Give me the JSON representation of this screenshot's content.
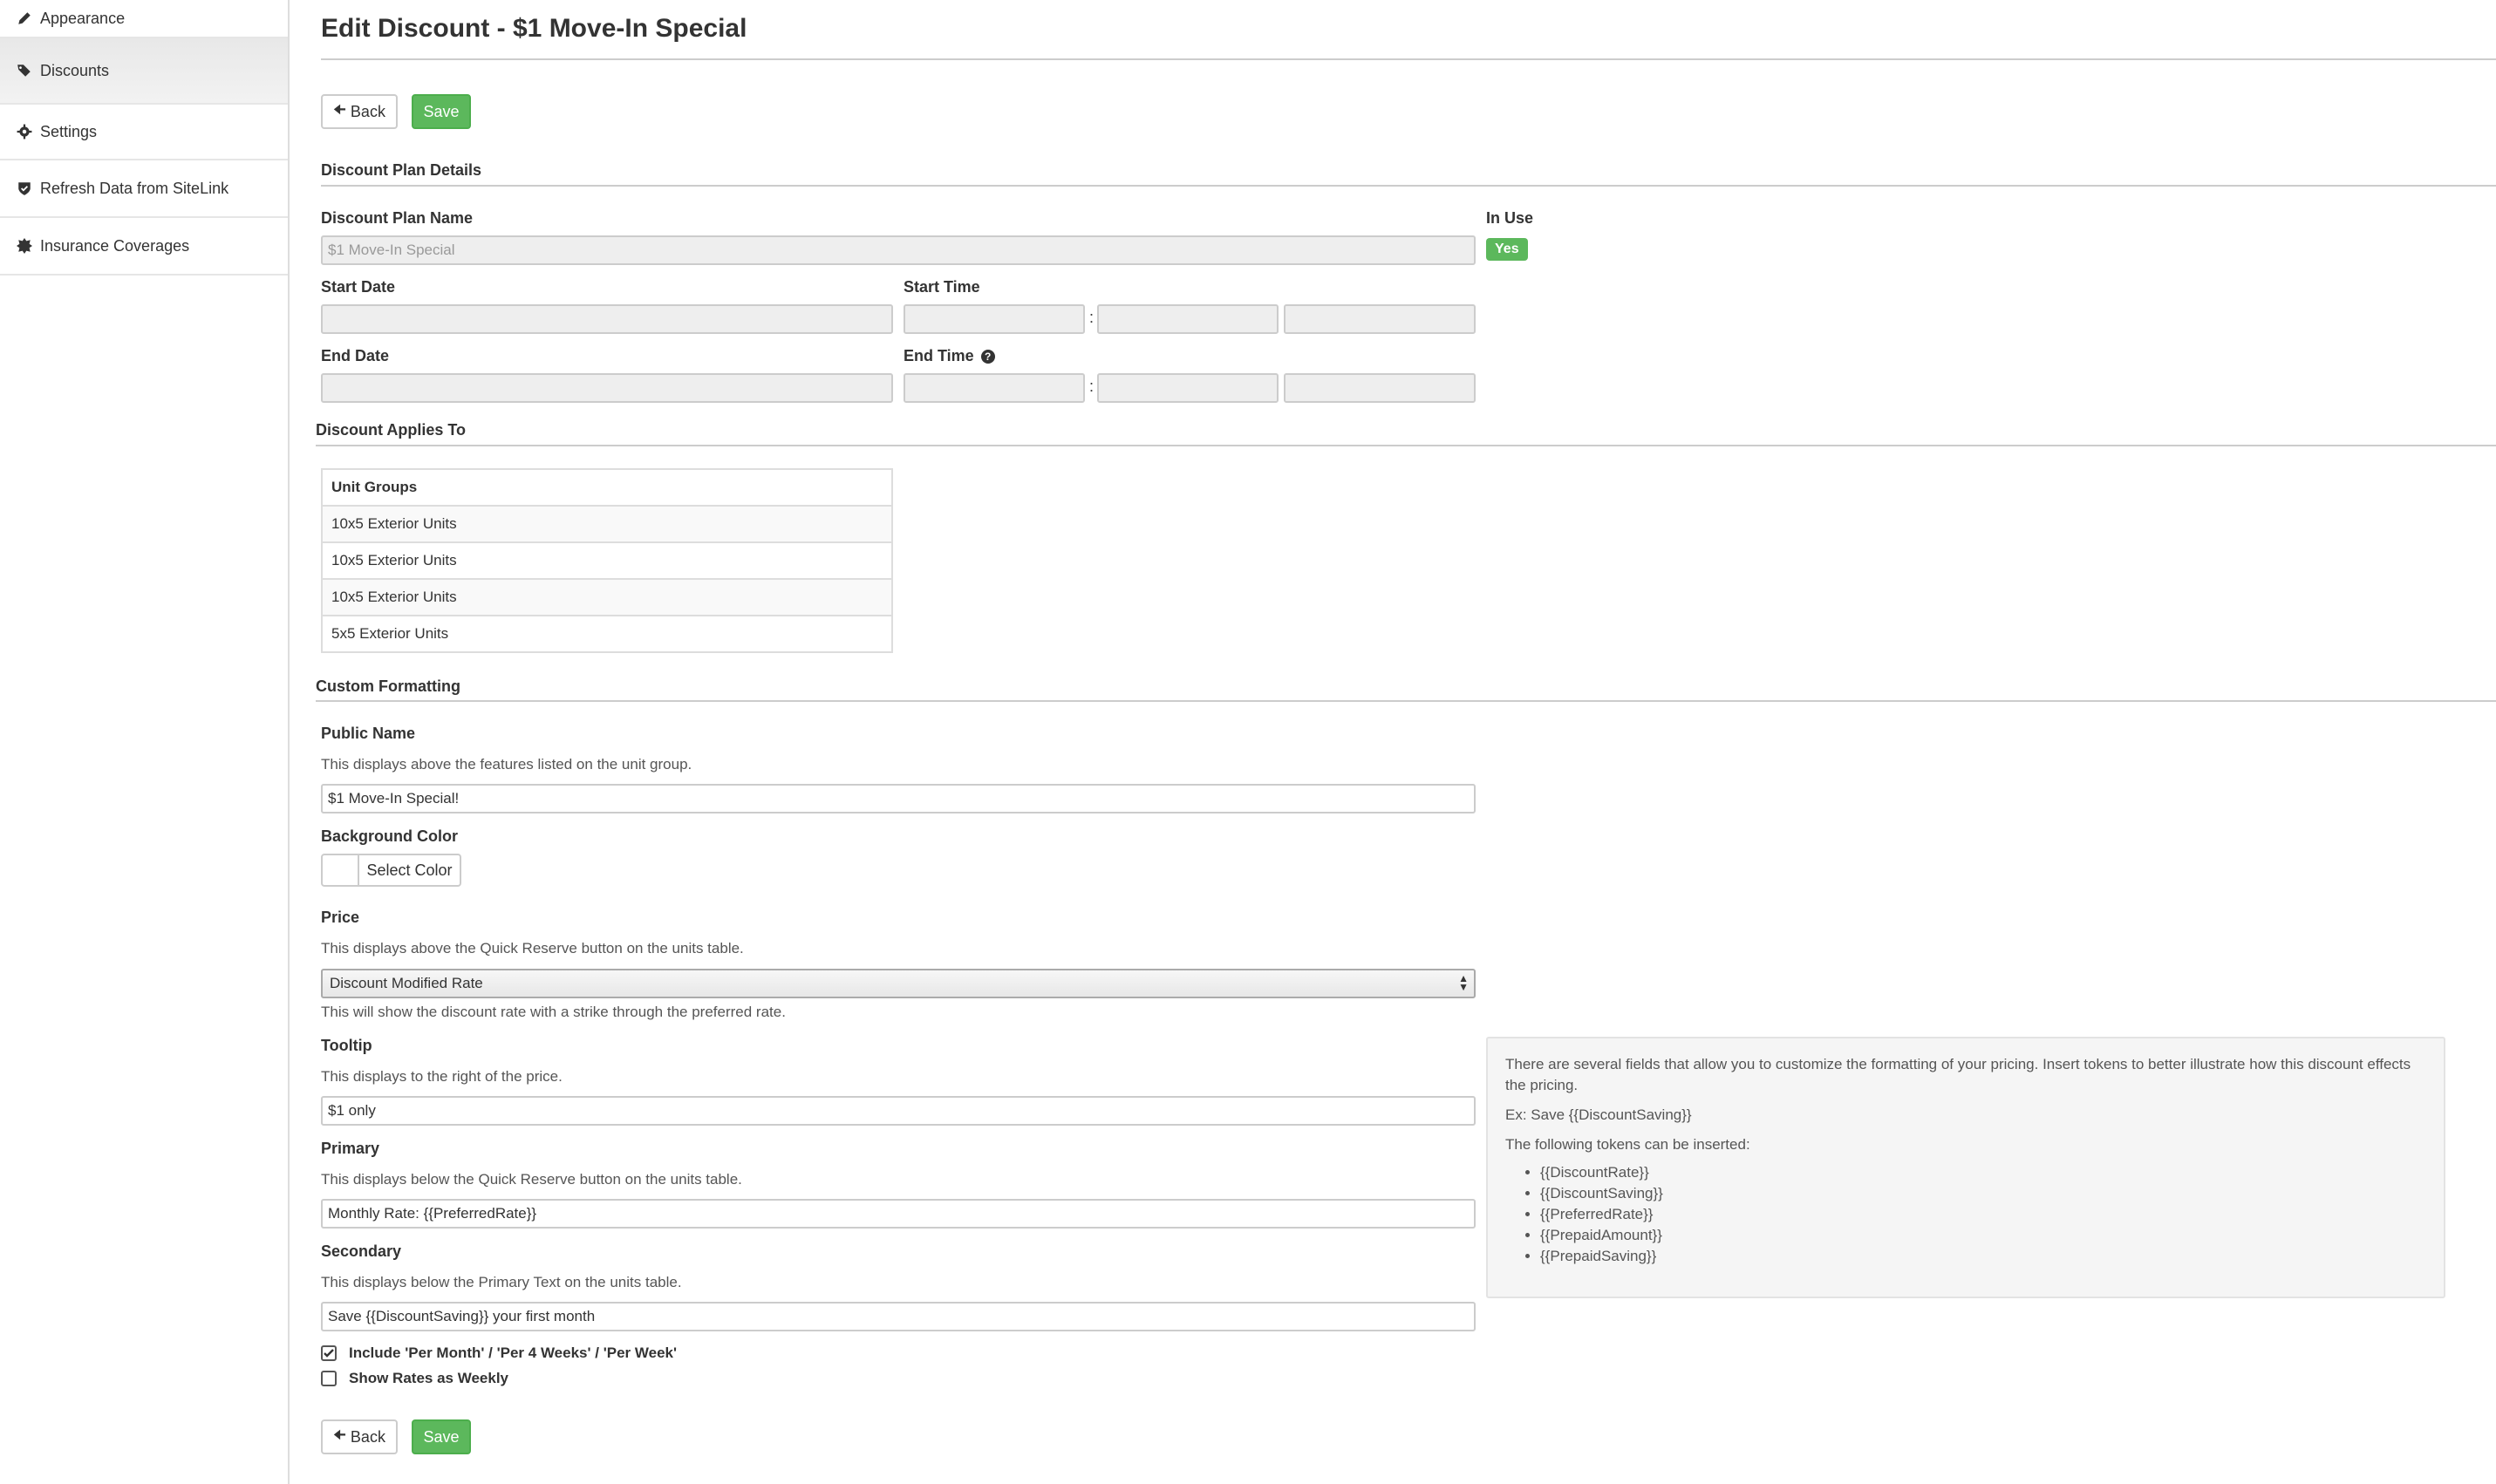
{
  "sidebar": {
    "items": [
      {
        "label": "Appearance",
        "icon": "pencil-icon"
      },
      {
        "label": "Discounts",
        "icon": "tags-icon"
      },
      {
        "label": "Settings",
        "icon": "gear-icon"
      },
      {
        "label": "Refresh Data from SiteLink",
        "icon": "shield-icon"
      },
      {
        "label": "Insurance Coverages",
        "icon": "certificate-icon"
      }
    ],
    "active_index": 1
  },
  "header": {
    "title": "Edit Discount - $1 Move-In Special"
  },
  "toolbar": {
    "back_label": "Back",
    "save_label": "Save"
  },
  "details": {
    "heading": "Discount Plan Details",
    "plan_name_label": "Discount Plan Name",
    "plan_name_value": "$1 Move-In Special",
    "in_use_label": "In Use",
    "in_use_value": "Yes",
    "start_date_label": "Start Date",
    "start_time_label": "Start Time",
    "end_date_label": "End Date",
    "end_time_label": "End Time",
    "time_separator": ":"
  },
  "applies": {
    "heading": "Discount Applies To",
    "table_header": "Unit Groups",
    "rows": [
      "10x5 Exterior Units",
      "10x5 Exterior Units",
      "10x5 Exterior Units",
      "5x5 Exterior Units"
    ]
  },
  "formatting": {
    "heading": "Custom Formatting",
    "public_name_label": "Public Name",
    "public_name_help": "This displays above the features listed on the unit group.",
    "public_name_value": "$1 Move-In Special!",
    "bg_color_label": "Background Color",
    "select_color_label": "Select Color",
    "price_label": "Price",
    "price_help": "This displays above the Quick Reserve button on the units table.",
    "price_selected": "Discount Modified Rate",
    "price_note": "This will show the discount rate with a strike through the preferred rate.",
    "tooltip_label": "Tooltip",
    "tooltip_help": "This displays to the right of the price.",
    "tooltip_value": "$1 only",
    "primary_label": "Primary",
    "primary_help": "This displays below the Quick Reserve button on the units table.",
    "primary_value": "Monthly Rate: {{PreferredRate}}",
    "secondary_label": "Secondary",
    "secondary_help": "This displays below the Primary Text on the units table.",
    "secondary_value": "Save {{DiscountSaving}} your first month",
    "include_per_label": "Include 'Per Month' / 'Per 4 Weeks' / 'Per Week'",
    "include_per_checked": true,
    "weekly_label": "Show Rates as Weekly",
    "weekly_checked": false
  },
  "info": {
    "intro": "There are several fields that allow you to customize the formatting of your pricing. Insert tokens to better illustrate how this discount effects the pricing.",
    "example": "Ex: Save {{DiscountSaving}}",
    "tokens_heading": "The following tokens can be inserted:",
    "tokens": [
      "{{DiscountRate}}",
      "{{DiscountSaving}}",
      "{{PreferredRate}}",
      "{{PrepaidAmount}}",
      "{{PrepaidSaving}}"
    ]
  },
  "colors": {
    "success": "#5cb85c",
    "border": "#cccccc",
    "disabled_bg": "#eeeeee"
  }
}
